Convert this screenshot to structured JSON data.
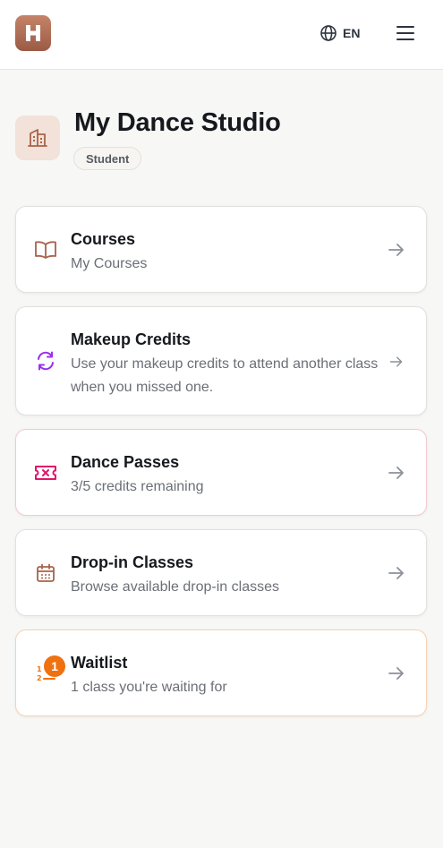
{
  "header": {
    "language": "EN"
  },
  "studio": {
    "name": "My Dance Studio",
    "role": "Student"
  },
  "cards": [
    {
      "title": "Courses",
      "subtitle": "My Courses",
      "icon": "book-open-icon"
    },
    {
      "title": "Makeup Credits",
      "subtitle": "Use your makeup credits to attend another class when you missed one.",
      "icon": "refresh-icon"
    },
    {
      "title": "Dance Passes",
      "subtitle": "3/5 credits remaining",
      "icon": "ticket-icon"
    },
    {
      "title": "Drop-in Classes",
      "subtitle": "Browse available drop-in classes",
      "icon": "calendar-icon"
    },
    {
      "title": "Waitlist",
      "subtitle": "1 class you're waiting for",
      "icon": "list-ordered-icon",
      "badge": "1"
    }
  ],
  "colors": {
    "brand": "#a8634b",
    "page_background": "#f7f7f5",
    "makeup_accent": "#9b2ff0",
    "passes_accent": "#e0146b",
    "waitlist_accent": "#f0710f",
    "arrow": "#8b9099"
  }
}
